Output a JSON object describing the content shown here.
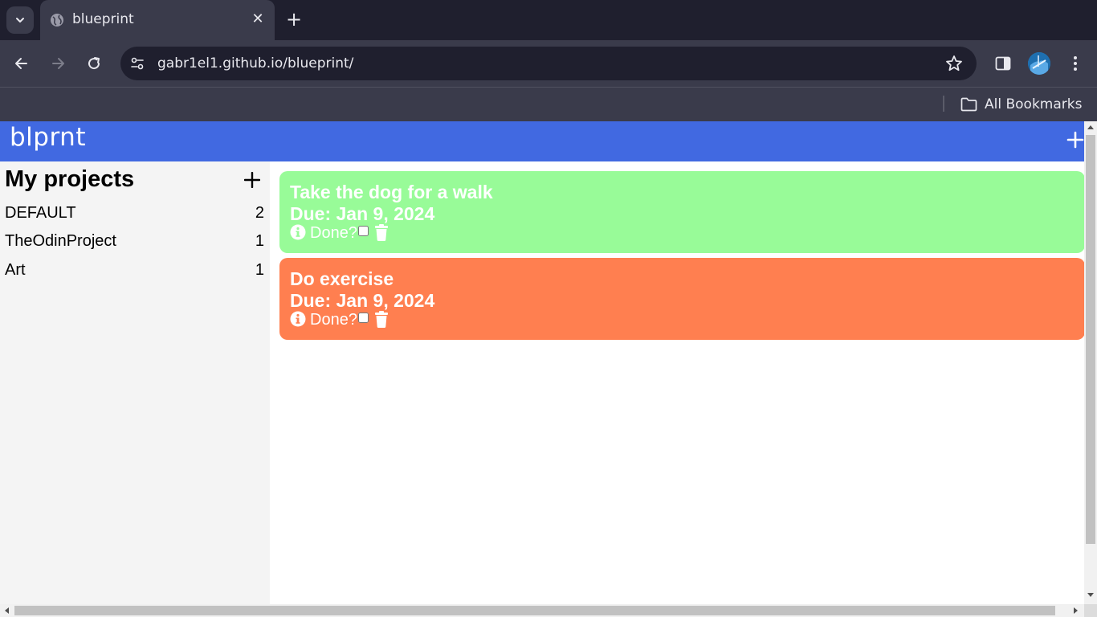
{
  "browser": {
    "tab": {
      "title": "blueprint",
      "icon": "globe-icon"
    },
    "url": "gabr1el1.github.io/blueprint/",
    "bookmarks": {
      "all_label": "All Bookmarks"
    },
    "colors": {
      "tabbar": "#1f1f2e",
      "toolbar": "#3a3b4b"
    }
  },
  "app": {
    "brand": "blprnt",
    "header_color": "#4169e1",
    "sidebar": {
      "title": "My projects",
      "projects": [
        {
          "name": "DEFAULT",
          "count": "2"
        },
        {
          "name": "TheOdinProject",
          "count": "1"
        },
        {
          "name": "Art",
          "count": "1"
        }
      ]
    },
    "todos": [
      {
        "title": "Take the dog for a walk",
        "due": "Due: Jan 9, 2024",
        "done_label": "Done?",
        "done": false,
        "color": "#98fb98"
      },
      {
        "title": "Do exercise",
        "due": "Due: Jan 9, 2024",
        "done_label": "Done?",
        "done": false,
        "color": "#ff7f50"
      }
    ]
  }
}
